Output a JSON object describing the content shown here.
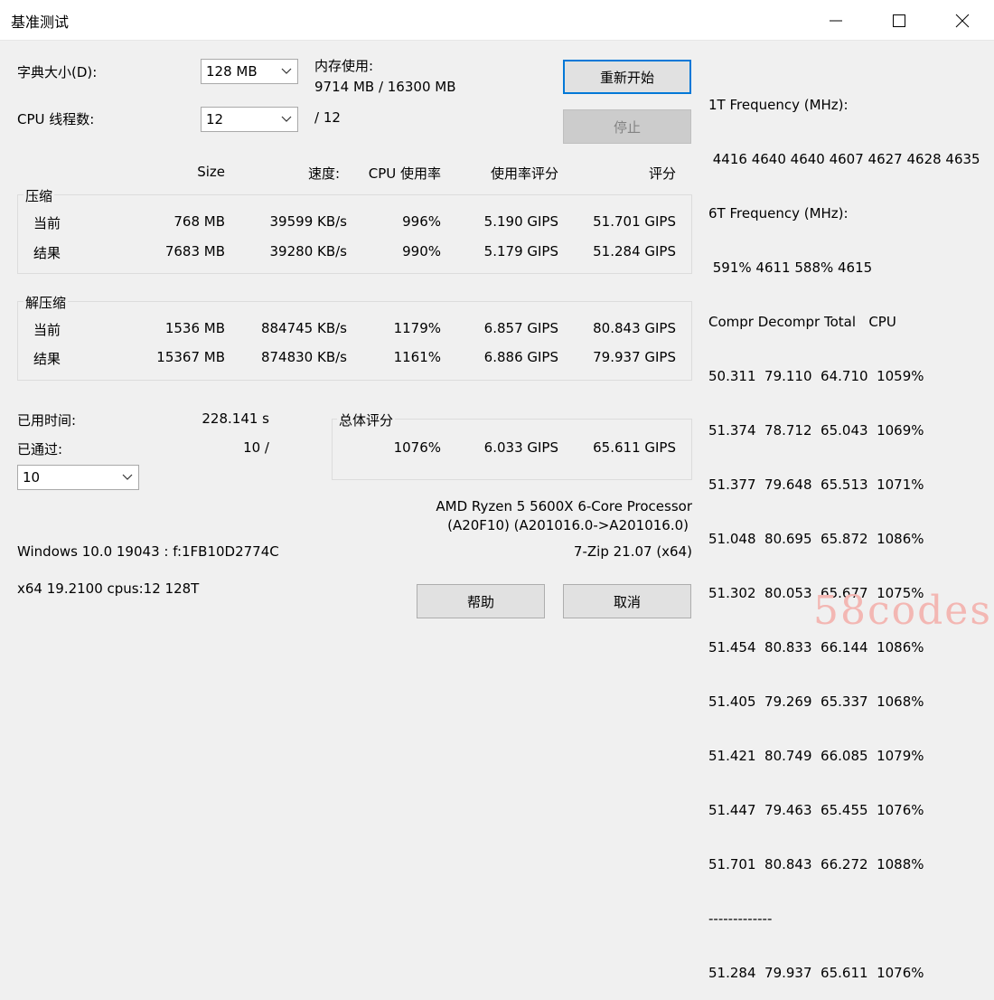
{
  "window": {
    "title": "基准测试"
  },
  "dict": {
    "label": "字典大小(D):",
    "value": "128 MB"
  },
  "threads": {
    "label": "CPU 线程数:",
    "value": "12",
    "total": "/ 12"
  },
  "memory": {
    "label": "内存使用:",
    "value": "9714 MB / 16300 MB"
  },
  "buttons": {
    "restart": "重新开始",
    "stop": "停止",
    "help": "帮助",
    "cancel": "取消"
  },
  "columns": {
    "size": "Size",
    "speed": "速度:",
    "usage": "CPU 使用率",
    "rating_usage": "使用率评分",
    "rating": "评分"
  },
  "compress": {
    "title": "压缩",
    "current": {
      "label": "当前",
      "size": "768 MB",
      "speed": "39599 KB/s",
      "usage": "996%",
      "rpu": "5.190 GIPS",
      "rating": "51.701 GIPS"
    },
    "result": {
      "label": "结果",
      "size": "7683 MB",
      "speed": "39280 KB/s",
      "usage": "990%",
      "rpu": "5.179 GIPS",
      "rating": "51.284 GIPS"
    }
  },
  "decompress": {
    "title": "解压缩",
    "current": {
      "label": "当前",
      "size": "1536 MB",
      "speed": "884745 KB/s",
      "usage": "1179%",
      "rpu": "6.857 GIPS",
      "rating": "80.843 GIPS"
    },
    "result": {
      "label": "结果",
      "size": "15367 MB",
      "speed": "874830 KB/s",
      "usage": "1161%",
      "rpu": "6.886 GIPS",
      "rating": "79.937 GIPS"
    }
  },
  "elapsed": {
    "label": "已用时间:",
    "value": "228.141 s"
  },
  "passes": {
    "label": "已通过:",
    "value": "10 /",
    "combo": "10"
  },
  "total": {
    "title": "总体评分",
    "usage": "1076%",
    "rpu": "6.033 GIPS",
    "rating": "65.611 GIPS"
  },
  "cpu": {
    "name": "AMD Ryzen 5 5600X 6-Core Processor",
    "id": "(A20F10) (A201016.0->A201016.0)"
  },
  "os": "Windows 10.0 19043 :  f:1FB10D2774C",
  "version": "7-Zip 21.07 (x64)",
  "arch": "x64 19.2100 cpus:12 128T",
  "log": [
    "1T Frequency (MHz):",
    " 4416 4640 4640 4607 4627 4628 4635",
    "6T Frequency (MHz):",
    " 591% 4611 588% 4615",
    "Compr Decompr Total   CPU",
    "50.311  79.110  64.710  1059%",
    "51.374  78.712  65.043  1069%",
    "51.377  79.648  65.513  1071%",
    "51.048  80.695  65.872  1086%",
    "51.302  80.053  65.677  1075%",
    "51.454  80.833  66.144  1086%",
    "51.405  79.269  65.337  1068%",
    "51.421  80.749  66.085  1079%",
    "51.447  79.463  65.455  1076%",
    "51.701  80.843  66.272  1088%",
    "-------------",
    "51.284  79.937  65.611  1076%"
  ],
  "watermark": "58codes"
}
